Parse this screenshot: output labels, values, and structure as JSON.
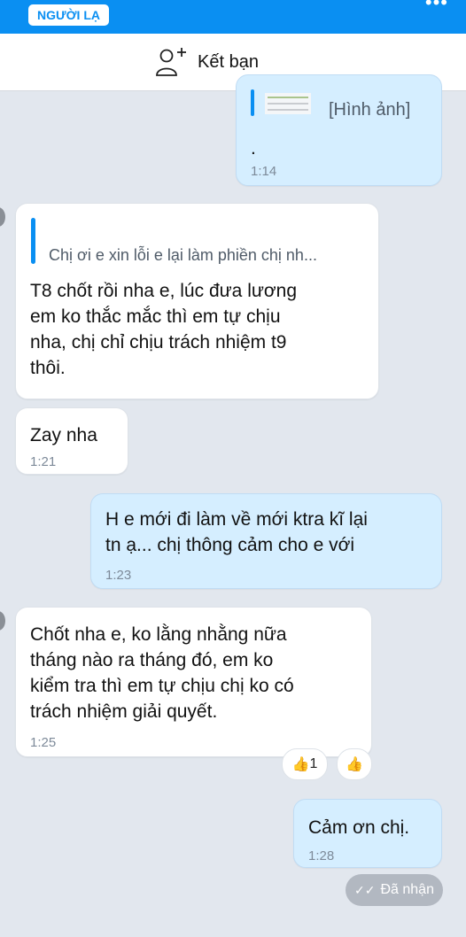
{
  "header": {
    "stranger_tag": "NGƯỜI LẠ",
    "menu_icon": "more-dots-icon",
    "add_friend_icon": "add-friend-icon",
    "add_friend_label": "Kết bạn"
  },
  "colors": {
    "accent": "#0a8ff2",
    "chat_background": "#e2e7ee",
    "my_bubble": "#d5eeff",
    "their_bubble": "#ffffff",
    "seen_pill": "#b2b8c1"
  },
  "messages": [
    {
      "sender": "me",
      "attachment_label": "[Hình ảnh]",
      "text": ".",
      "time": "1:14"
    },
    {
      "sender": "other",
      "quote": "Chị ơi e xin lỗi e lại làm phiền chị nh...",
      "text": "T8 chốt rồi nha e, lúc đưa lương\nem ko thắc mắc thì em tự chịu\nnha, chị chỉ chịu trách nhiệm t9\nthôi."
    },
    {
      "sender": "other",
      "text": "Zay nha",
      "time": "1:21"
    },
    {
      "sender": "me",
      "text": "H e mới đi làm về mới ktra kĩ lại\ntn ạ... chị thông cảm cho e với",
      "time": "1:23"
    },
    {
      "sender": "other",
      "text": "Chốt nha e, ko lằng nhằng nữa\ntháng nào ra tháng đó, em ko\nkiểm tra thì em tự chịu chị ko có\ntrách nhiệm giải quyết.",
      "time": "1:25",
      "reaction_count": "1",
      "reaction_icon": "thumbs-up-icon"
    },
    {
      "sender": "me",
      "text": "Cảm ơn chị.",
      "time": "1:28"
    }
  ],
  "status": {
    "label": "Đã nhận",
    "icon": "double-check-icon"
  }
}
